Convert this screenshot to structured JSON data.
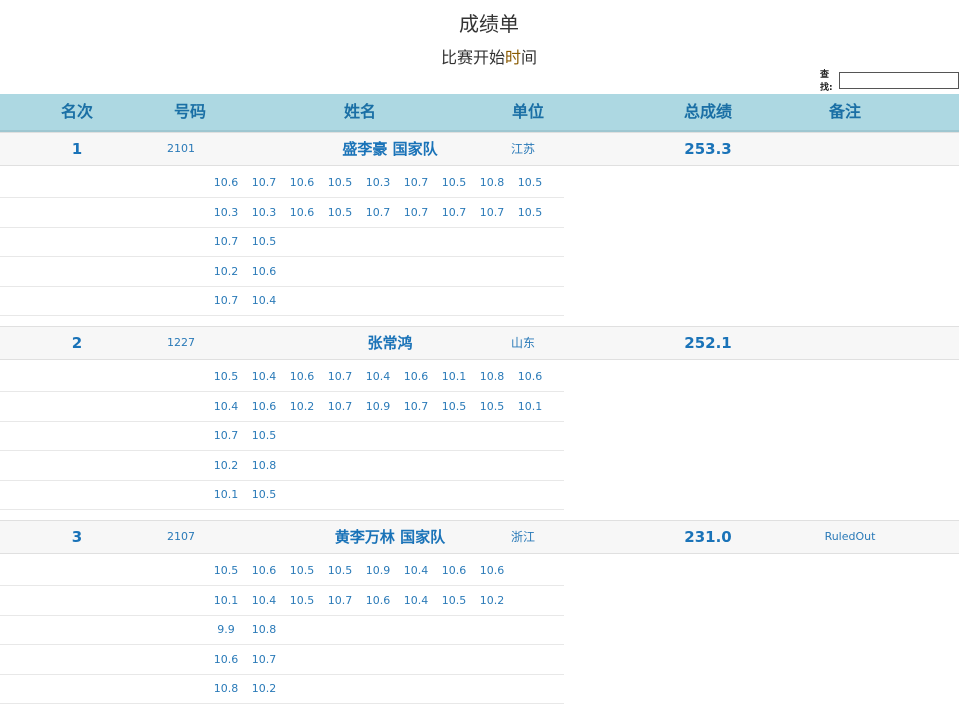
{
  "page": {
    "title": "成绩单",
    "subtitle_a": "比赛开始",
    "subtitle_b": "时",
    "subtitle_c": "间"
  },
  "search": {
    "label": "查找:",
    "value": ""
  },
  "table": {
    "headers": [
      "名次",
      "号码",
      "姓名",
      "单位",
      "总成绩",
      "备注"
    ]
  },
  "athletes": [
    {
      "rank": "1",
      "number": "2101",
      "name": "盛李豪 国家队",
      "unit": "江苏",
      "total": "253.3",
      "note": "",
      "rows": [
        [
          "10.6",
          "10.7",
          "10.6",
          "10.5",
          "10.3",
          "10.7",
          "10.5",
          "10.8",
          "10.5"
        ],
        [
          "10.3",
          "10.3",
          "10.6",
          "10.5",
          "10.7",
          "10.7",
          "10.7",
          "10.7",
          "10.5"
        ],
        [
          "10.7",
          "10.5"
        ],
        [
          "10.2",
          "10.6"
        ],
        [
          "10.7",
          "10.4"
        ]
      ]
    },
    {
      "rank": "2",
      "number": "1227",
      "name": "张常鸿",
      "unit": "山东",
      "total": "252.1",
      "note": "",
      "rows": [
        [
          "10.5",
          "10.4",
          "10.6",
          "10.7",
          "10.4",
          "10.6",
          "10.1",
          "10.8",
          "10.6"
        ],
        [
          "10.4",
          "10.6",
          "10.2",
          "10.7",
          "10.9",
          "10.7",
          "10.5",
          "10.5",
          "10.1"
        ],
        [
          "10.7",
          "10.5"
        ],
        [
          "10.2",
          "10.8"
        ],
        [
          "10.1",
          "10.5"
        ]
      ]
    },
    {
      "rank": "3",
      "number": "2107",
      "name": "黄李万林 国家队",
      "unit": "浙江",
      "total": "231.0",
      "note": "RuledOut",
      "rows": [
        [
          "10.5",
          "10.6",
          "10.5",
          "10.5",
          "10.9",
          "10.4",
          "10.6",
          "10.6"
        ],
        [
          "10.1",
          "10.4",
          "10.5",
          "10.7",
          "10.6",
          "10.4",
          "10.5",
          "10.2"
        ],
        [
          "9.9",
          "10.8"
        ],
        [
          "10.6",
          "10.7"
        ],
        [
          "10.8",
          "10.2"
        ]
      ]
    }
  ]
}
